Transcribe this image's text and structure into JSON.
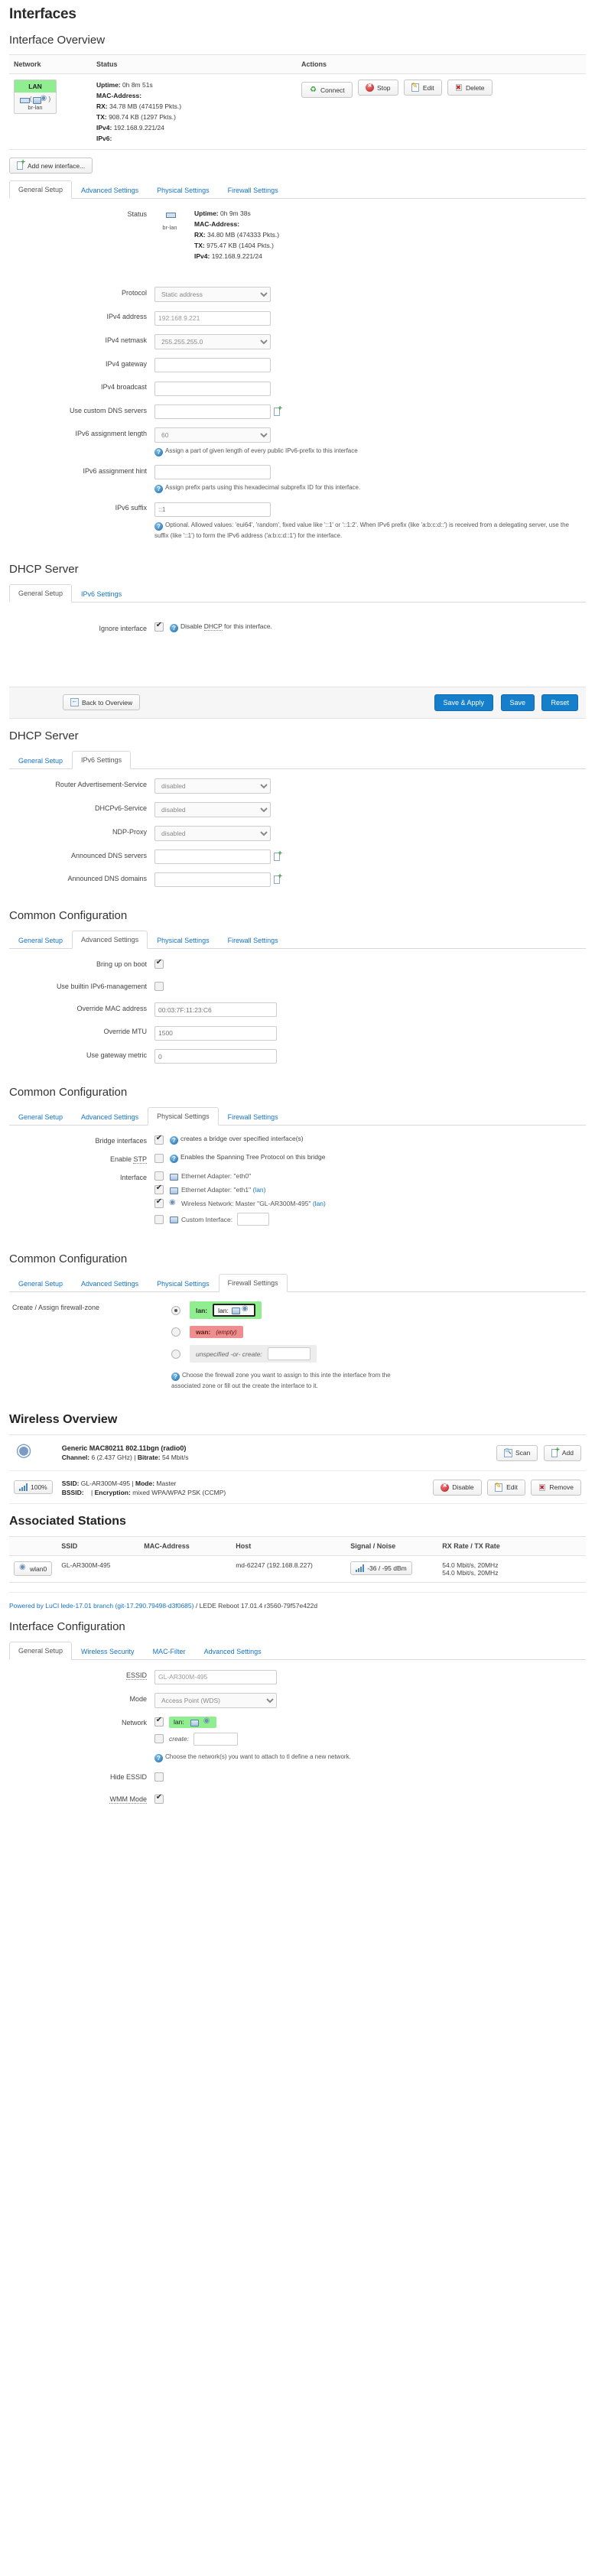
{
  "page": {
    "title": "Interfaces",
    "interface_overview_title": "Interface Overview",
    "dhcp_server_title": "DHCP Server",
    "common_config_title": "Common Configuration",
    "wireless_overview_title": "Wireless Overview",
    "associated_stations_title": "Associated Stations",
    "interface_configuration_title": "Interface Configuration"
  },
  "overview": {
    "columns": {
      "network": "Network",
      "status": "Status",
      "actions": "Actions"
    },
    "row": {
      "badge": "LAN",
      "device": "br-lan",
      "uptime_label": "Uptime:",
      "uptime": "0h 8m 51s",
      "mac_label": "MAC-Address:",
      "mac": "",
      "rx_label": "RX:",
      "rx": "34.78 MB (474159 Pkts.)",
      "tx_label": "TX:",
      "tx": "908.74 KB (1297 Pkts.)",
      "ipv4_label": "IPv4:",
      "ipv4": "192.168.9.221/24",
      "ipv6_label": "IPv6:",
      "ipv6": ""
    },
    "actions": {
      "connect": "Connect",
      "stop": "Stop",
      "edit": "Edit",
      "delete": "Delete"
    },
    "add_new_interface": "Add new interface..."
  },
  "iface_tabs": [
    {
      "label": "General Setup",
      "active": true
    },
    {
      "label": "Advanced Settings",
      "active": false
    },
    {
      "label": "Physical Settings",
      "active": false
    },
    {
      "label": "Firewall Settings",
      "active": false
    }
  ],
  "general_setup": {
    "status_label": "Status",
    "device": "br-lan",
    "uptime_label": "Uptime:",
    "uptime": "0h 9m 38s",
    "mac_label": "MAC-Address:",
    "mac": "",
    "rx_label": "RX:",
    "rx": "34.80 MB (474333 Pkts.)",
    "tx_label": "TX:",
    "tx": "975.47 KB (1404 Pkts.)",
    "ipv4_label": "IPv4:",
    "ipv4": "192.168.9.221/24",
    "fields": {
      "protocol_label": "Protocol",
      "protocol_value": "Static address",
      "ipv4_address_label": "IPv4 address",
      "ipv4_address_value": "192.168.9.221",
      "ipv4_netmask_label": "IPv4 netmask",
      "ipv4_netmask_value": "255.255.255.0",
      "ipv4_gateway_label": "IPv4 gateway",
      "ipv4_gateway_value": "",
      "ipv4_broadcast_label": "IPv4 broadcast",
      "ipv4_broadcast_value": "",
      "custom_dns_label": "Use custom DNS servers",
      "custom_dns_value": "",
      "ipv6_assign_len_label": "IPv6 assignment length",
      "ipv6_assign_len_value": "60",
      "ipv6_assign_len_hint": "Assign a part of given length of every public IPv6-prefix to this interface",
      "ipv6_assign_hint_label": "IPv6 assignment hint",
      "ipv6_assign_hint_value": "",
      "ipv6_assign_hint_hint": "Assign prefix parts using this hexadecimal subprefix ID for this interface.",
      "ipv6_suffix_label": "IPv6 suffix",
      "ipv6_suffix_placeholder": "::1",
      "ipv6_suffix_hint": "Optional. Allowed values: 'eui64', 'random', fixed value like '::1' or '::1:2'. When IPv6 prefix (like 'a:b:c:d::') is received from a delegating server, use the suffix (like '::1') to form the IPv6 address ('a:b:c:d::1') for the interface."
    }
  },
  "dhcp_general": {
    "tabs": [
      {
        "label": "General Setup",
        "active": true
      },
      {
        "label": "IPv6 Settings",
        "active": false
      }
    ],
    "ignore_interface_label": "Ignore interface",
    "ignore_interface_checked": true,
    "ignore_interface_hint_pre": "Disable ",
    "ignore_interface_hint_term": "DHCP",
    "ignore_interface_hint_post": " for this interface."
  },
  "buttons_bar": {
    "back_to_overview": "Back to Overview",
    "save_apply": "Save & Apply",
    "save": "Save",
    "reset": "Reset"
  },
  "dhcp_ipv6": {
    "tabs": [
      {
        "label": "General Setup",
        "active": false
      },
      {
        "label": "IPv6 Settings",
        "active": true
      }
    ],
    "router_adv_label": "Router Advertisement-Service",
    "router_adv_value": "disabled",
    "dhcpv6_label": "DHCPv6-Service",
    "dhcpv6_value": "disabled",
    "ndp_label": "NDP-Proxy",
    "ndp_value": "disabled",
    "announced_dns_servers_label": "Announced DNS servers",
    "announced_dns_servers_value": "",
    "announced_dns_domains_label": "Announced DNS domains",
    "announced_dns_domains_value": ""
  },
  "common_advanced": {
    "tabs": [
      {
        "label": "General Setup",
        "active": false
      },
      {
        "label": "Advanced Settings",
        "active": true
      },
      {
        "label": "Physical Settings",
        "active": false
      },
      {
        "label": "Firewall Settings",
        "active": false
      }
    ],
    "bring_up_on_boot_label": "Bring up on boot",
    "bring_up_on_boot_checked": true,
    "builtin_ipv6_label": "Use builtin IPv6-management",
    "builtin_ipv6_checked": false,
    "override_mac_label": "Override MAC address",
    "override_mac_placeholder": "00:03:7F:11:23:C6",
    "override_mtu_label": "Override MTU",
    "override_mtu_placeholder": "1500",
    "gateway_metric_label": "Use gateway metric",
    "gateway_metric_placeholder": "0"
  },
  "common_physical": {
    "tabs": [
      {
        "label": "General Setup",
        "active": false
      },
      {
        "label": "Advanced Settings",
        "active": false
      },
      {
        "label": "Physical Settings",
        "active": true
      },
      {
        "label": "Firewall Settings",
        "active": false
      }
    ],
    "bridge_label": "Bridge interfaces",
    "bridge_checked": true,
    "bridge_hint": "creates a bridge over specified interface(s)",
    "stp_label_pre": "Enable ",
    "stp_label_term": "STP",
    "stp_checked": false,
    "stp_hint": "Enables the Spanning Tree Protocol on this bridge",
    "interface_label": "Interface",
    "interfaces": [
      {
        "checked": false,
        "icon": "ethernet-icon",
        "text": "Ethernet Adapter: \"eth0\"",
        "suffix": ""
      },
      {
        "checked": true,
        "icon": "ethernet-icon",
        "text": "Ethernet Adapter: \"eth1\" ",
        "suffix": "(lan)"
      },
      {
        "checked": true,
        "icon": "wifi-icon",
        "text": "Wireless Network: Master \"GL-AR300M-495\" ",
        "suffix": "(lan)"
      },
      {
        "checked": false,
        "icon": "ethernet-icon",
        "text": "Custom Interface:",
        "suffix": ""
      }
    ],
    "custom_interface_value": ""
  },
  "common_firewall": {
    "tabs": [
      {
        "label": "General Setup",
        "active": false
      },
      {
        "label": "Advanced Settings",
        "active": false
      },
      {
        "label": "Physical Settings",
        "active": false
      },
      {
        "label": "Firewall Settings",
        "active": true
      }
    ],
    "zone_label": "Create / Assign firewall-zone",
    "zones": [
      {
        "selected": true,
        "name": "lan:",
        "inner": "lan:",
        "style": "lan"
      },
      {
        "selected": false,
        "name": "wan:",
        "inner": "(empty)",
        "style": "wan"
      },
      {
        "selected": false,
        "name": "unspecified -or- create:",
        "inner": "",
        "style": "none"
      }
    ],
    "hint": "Choose the firewall zone you want to assign to this inte the interface from the associated zone or fill out the create the interface to it."
  },
  "wireless": {
    "radio_name": "Generic MAC80211 802.11bgn (radio0)",
    "radio_sub_channel_label": "Channel:",
    "radio_sub_channel": "6 (2.437 GHz)",
    "radio_sub_bitrate_label": "Bitrate:",
    "radio_sub_bitrate": "54 Mbit/s",
    "scan_button": "Scan",
    "add_button": "Add",
    "signal_percent": "100%",
    "ssid_label": "SSID:",
    "ssid": "GL-AR300M-495",
    "mode_label": "Mode:",
    "mode": "Master",
    "bssid_label": "BSSID:",
    "bssid": "",
    "encryption_label": "Encryption:",
    "encryption": "mixed WPA/WPA2 PSK (CCMP)",
    "disable_button": "Disable",
    "edit_button": "Edit",
    "remove_button": "Remove"
  },
  "stations": {
    "columns": [
      "SSID",
      "MAC-Address",
      "Host",
      "Signal / Noise",
      "RX Rate / TX Rate"
    ],
    "rows": [
      {
        "iface": "wlan0",
        "ssid": "GL-AR300M-495",
        "mac": "",
        "host": "md-62247 (192.168.8.227)",
        "signal": "-36 / -95 dBm",
        "rx_rate": "54.0 Mbit/s, 20MHz",
        "tx_rate": "54.0 Mbit/s, 20MHz"
      }
    ]
  },
  "footer": {
    "link_text": "Powered by LuCI lede-17.01 branch (git-17.290.79498-d3f0685)",
    "plain_text": " / LEDE Reboot 17.01.4 r3560-79f57e422d"
  },
  "iface_config": {
    "tabs": [
      {
        "label": "General Setup",
        "active": true
      },
      {
        "label": "Wireless Security",
        "active": false
      },
      {
        "label": "MAC-Filter",
        "active": false
      },
      {
        "label": "Advanced Settings",
        "active": false
      }
    ],
    "essid_label": "ESSID",
    "essid_value": "GL-AR300M-495",
    "mode_label": "Mode",
    "mode_value": "Access Point (WDS)",
    "network_label": "Network",
    "network_lan_checked": true,
    "network_lan_chip": "lan:",
    "network_create_checked": false,
    "network_create_label": "create:",
    "network_create_value": "",
    "network_hint": "Choose the network(s) you want to attach to tl define a new network.",
    "hide_essid_label": "Hide ESSID",
    "hide_essid_checked": false,
    "wmm_mode_label": "WMM Mode",
    "wmm_mode_checked": true
  }
}
